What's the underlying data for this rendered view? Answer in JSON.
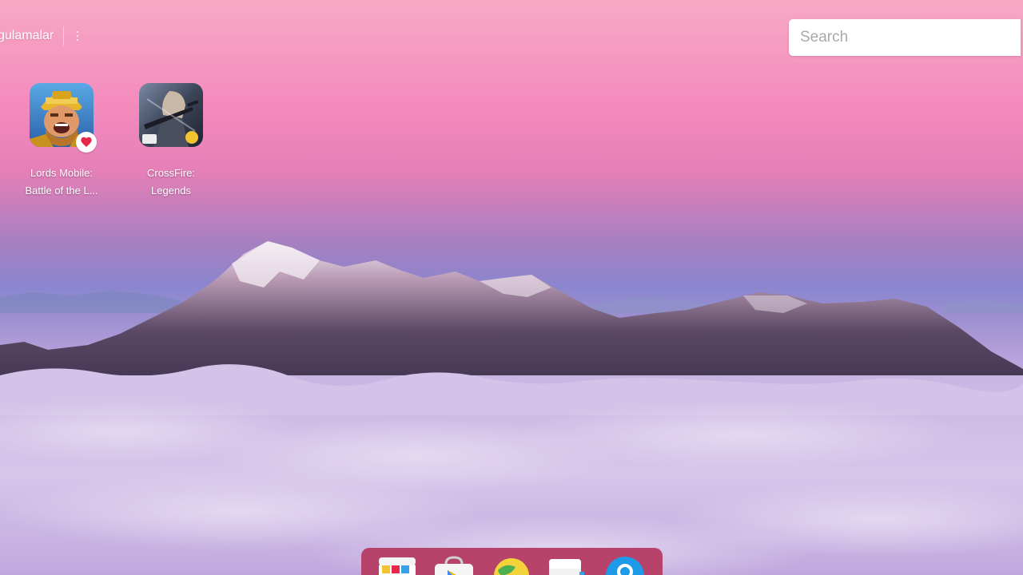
{
  "header": {
    "app_title": "gulamalar"
  },
  "search": {
    "placeholder": "Search",
    "value": ""
  },
  "apps": [
    {
      "id": "lords-mobile",
      "label_line1": "Lords Mobile:",
      "label_line2": "Battle of the L...",
      "icon": "lords-mobile-icon",
      "favorite": true
    },
    {
      "id": "crossfire-legends",
      "label_line1": "CrossFire:",
      "label_line2": "Legends",
      "icon": "crossfire-legends-icon",
      "favorite": false
    }
  ],
  "dock": {
    "items": [
      {
        "icon": "app-center-icon"
      },
      {
        "icon": "play-store-icon"
      },
      {
        "icon": "browser-globe-icon"
      },
      {
        "icon": "file-manager-icon"
      },
      {
        "icon": "help-icon"
      }
    ]
  },
  "colors": {
    "dock_background": "#b7436b",
    "search_background": "#ffffff",
    "favorite_heart": "#e8284a"
  }
}
